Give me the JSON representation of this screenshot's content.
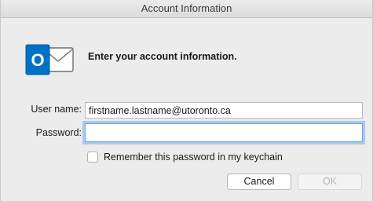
{
  "window": {
    "title": "Account Information"
  },
  "app_icon": {
    "name": "outlook-icon",
    "letter": "O",
    "brand_color": "#0072c6"
  },
  "heading": "Enter your account information.",
  "form": {
    "username_label": "User name:",
    "username_value": "firstname.lastname@utoronto.ca",
    "password_label": "Password:",
    "password_value": "",
    "remember_label": "Remember this password in my keychain",
    "remember_checked": false
  },
  "buttons": {
    "cancel_label": "Cancel",
    "ok_label": "OK",
    "ok_enabled": false
  }
}
